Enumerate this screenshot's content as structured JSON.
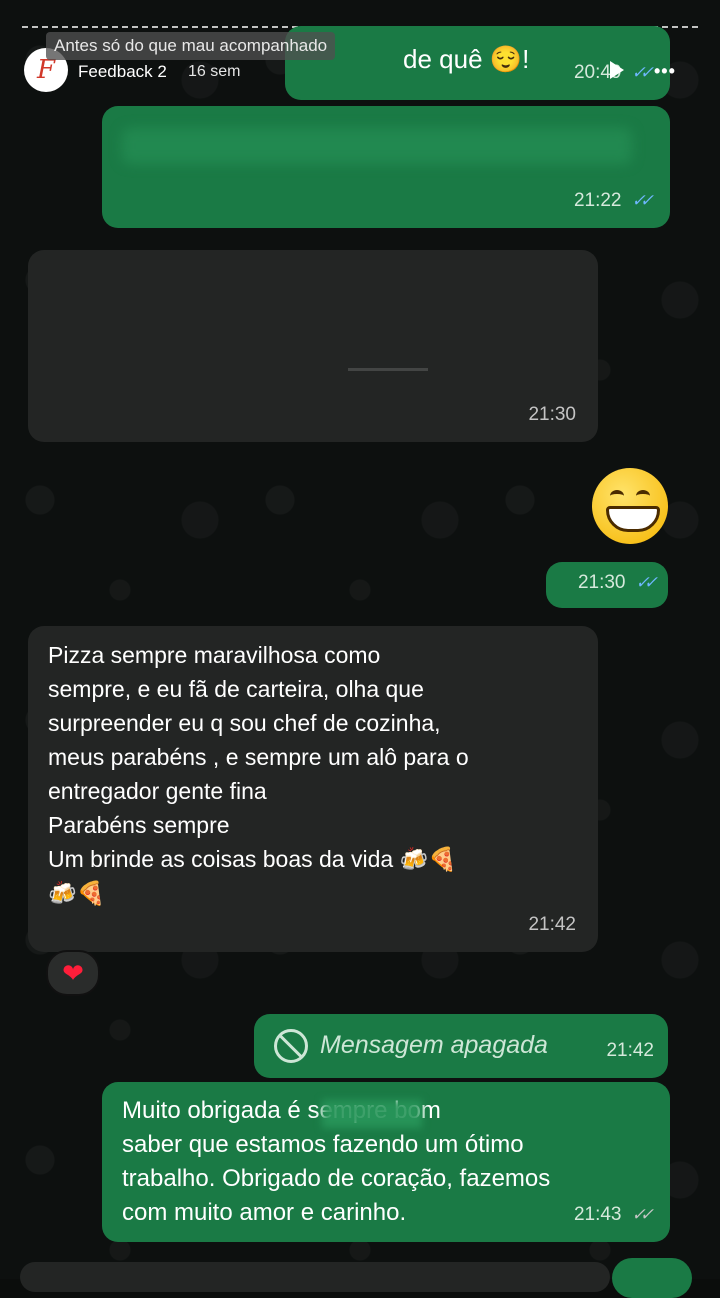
{
  "story": {
    "caption": "Antes só do que mau acompanhado",
    "account_name": "Feedback 2",
    "age": "16 sem",
    "avatar_letter": "F"
  },
  "messages": [
    {
      "id": "m1",
      "side": "sent",
      "text": "de quê 😌!",
      "time": "20:49"
    },
    {
      "id": "m2",
      "side": "sent",
      "text": "",
      "time": "21:22"
    },
    {
      "id": "m3",
      "side": "received",
      "text": "",
      "time": "21:30"
    },
    {
      "id": "m4",
      "side": "sent",
      "emoji": "😁",
      "time": "21:30"
    },
    {
      "id": "m5",
      "side": "received",
      "text": "Pizza sempre maravilhosa  como\nsempre, e eu fã  de carteira, olha que\nsurpreender eu q sou chef de cozinha,\nmeus parabéns , e sempre um alô para o\nentregador gente fina\nParabéns sempre\nUm brinde as coisas boas da vida 🍻🍕\n🍻🍕",
      "time": "21:42",
      "reaction": "❤"
    },
    {
      "id": "m6",
      "side": "sent",
      "text": "Mensagem apagada",
      "time": "21:42",
      "deleted": true
    },
    {
      "id": "m7",
      "side": "sent",
      "text": "Muito obrigada            é sempre bom\nsaber que estamos fazendo um ótimo\ntrabalho. Obrigado de coração, fazemos\ncom muito amor e carinho.",
      "time": "21:43"
    }
  ],
  "colors": {
    "sent_bubble": "#1a7a45",
    "received_bubble": "#232524",
    "read_ticks": "#6fb7ff"
  }
}
